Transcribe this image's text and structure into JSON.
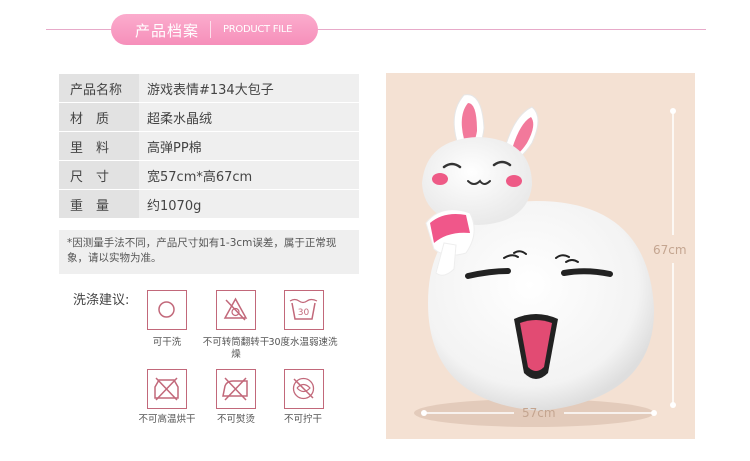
{
  "header": {
    "title_cn": "产品档案",
    "title_en": "PRODUCT FILE"
  },
  "specs": [
    {
      "label": "产品名称",
      "value": "游戏表情#134大包子"
    },
    {
      "label": "材　质",
      "value": "超柔水晶绒"
    },
    {
      "label": "里　料",
      "value": "高弹PP棉"
    },
    {
      "label": "尺　寸",
      "value": "宽57cm*高67cm"
    },
    {
      "label": "重　量",
      "value": "约1070g"
    }
  ],
  "note": "*因测量手法不同，产品尺寸如有1-3cm误差，属于正常现象，请以实物为准。",
  "washing": {
    "title": "洗涤建议:",
    "icons": [
      {
        "icon": "no-dry-clean-icon",
        "label": "可干洗"
      },
      {
        "icon": "no-tumble-dry-icon",
        "label": "不可转筒翻转干燥"
      },
      {
        "icon": "wash-30-icon",
        "text": "30",
        "label": "30度水温弱速洗"
      },
      {
        "icon": "no-high-temp-dry-icon",
        "label": "不可高温烘干"
      },
      {
        "icon": "no-iron-icon",
        "label": "不可熨烫"
      },
      {
        "icon": "no-wring-icon",
        "label": "不可拧干"
      }
    ]
  },
  "photo": {
    "height_label": "67cm",
    "width_label": "57cm"
  },
  "colors": {
    "accent_pink": "#f68fba",
    "icon_border": "#c2687a",
    "photo_bg": "#f4e1d3"
  }
}
